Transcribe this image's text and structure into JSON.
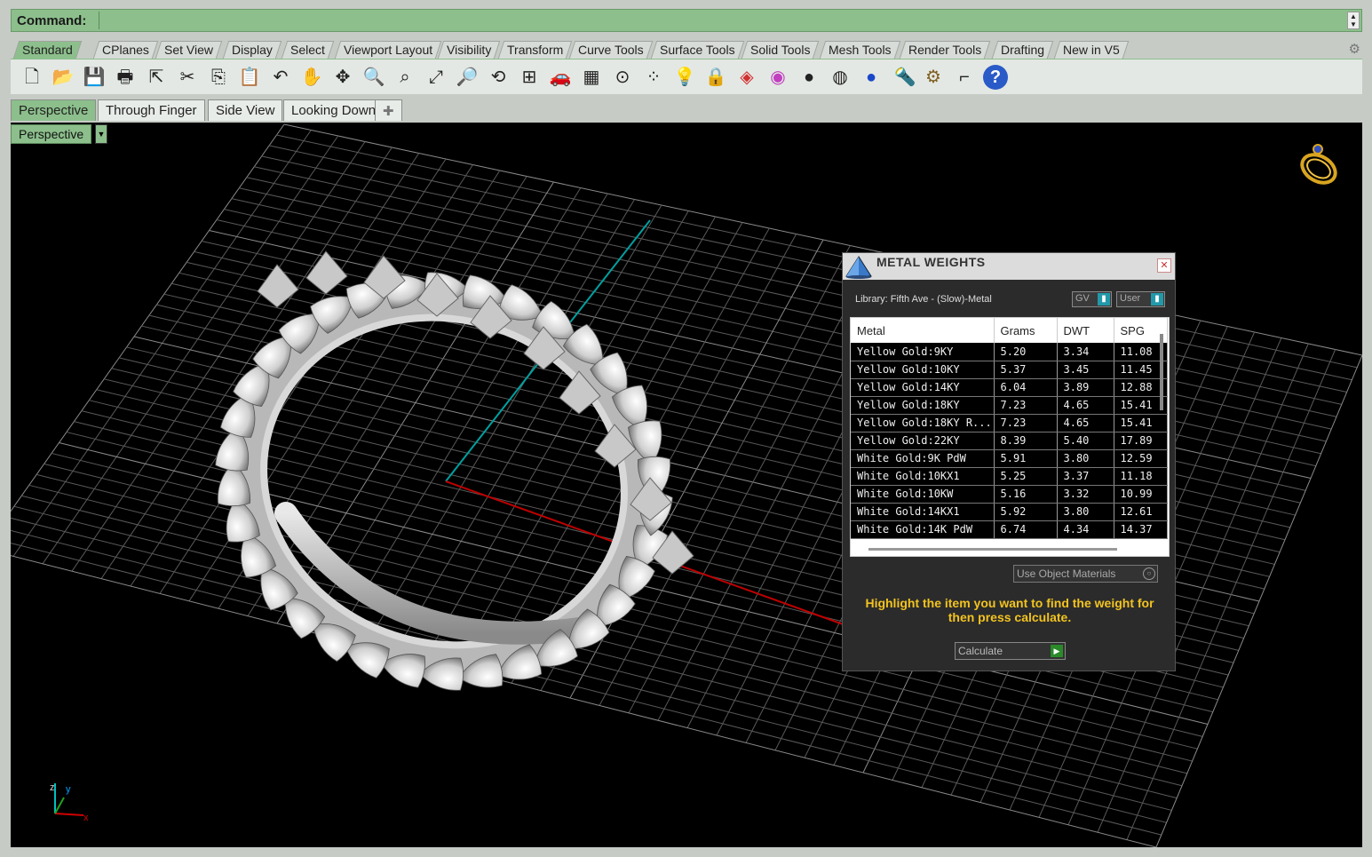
{
  "command": {
    "label": "Command:",
    "value": ""
  },
  "toolbar_tabs": [
    "Standard",
    "CPlanes",
    "Set View",
    "Display",
    "Select",
    "Viewport Layout",
    "Visibility",
    "Transform",
    "Curve Tools",
    "Surface Tools",
    "Solid Tools",
    "Mesh Tools",
    "Render Tools",
    "Drafting",
    "New in V5"
  ],
  "toolbar_icons": [
    "new-file-icon",
    "open-folder-icon",
    "save-icon",
    "print-icon",
    "export-icon",
    "cut-icon",
    "copy-icon",
    "paste-icon",
    "undo-icon",
    "pan-hand-icon",
    "move-icon",
    "zoom-icon",
    "zoom-window-icon",
    "zoom-extents-icon",
    "zoom-selected-icon",
    "rotate-view-icon",
    "four-viewports-icon",
    "car-icon",
    "grid-icon",
    "snap-icon",
    "points-icon",
    "light-bulb-icon",
    "lock-icon",
    "material-icon",
    "color-wheel-icon",
    "shaded-sphere-icon",
    "rendered-sphere-icon",
    "blue-sphere-icon",
    "flashlight-icon",
    "gear-icon",
    "dimension-icon",
    "help-icon"
  ],
  "viewport_tabs": [
    "Perspective",
    "Through Finger",
    "Side View",
    "Looking Down"
  ],
  "viewport": {
    "label": "Perspective"
  },
  "metal_weights": {
    "title": "METAL WEIGHTS",
    "library": "Library: Fifth Ave - (Slow)-Metal",
    "gv_button": "GV",
    "user_button": "User",
    "columns": [
      "Metal",
      "Grams",
      "DWT",
      "SPG"
    ],
    "rows": [
      [
        "Yellow Gold:9KY",
        "5.20",
        "3.34",
        "11.08"
      ],
      [
        "Yellow Gold:10KY",
        "5.37",
        "3.45",
        "11.45"
      ],
      [
        "Yellow Gold:14KY",
        "6.04",
        "3.89",
        "12.88"
      ],
      [
        "Yellow Gold:18KY",
        "7.23",
        "4.65",
        "15.41"
      ],
      [
        "Yellow Gold:18KY R...",
        "7.23",
        "4.65",
        "15.41"
      ],
      [
        "Yellow Gold:22KY",
        "8.39",
        "5.40",
        "17.89"
      ],
      [
        "White Gold:9K PdW",
        "5.91",
        "3.80",
        "12.59"
      ],
      [
        "White Gold:10KX1",
        "5.25",
        "3.37",
        "11.18"
      ],
      [
        "White Gold:10KW",
        "5.16",
        "3.32",
        "10.99"
      ],
      [
        "White Gold:14KX1",
        "5.92",
        "3.80",
        "12.61"
      ],
      [
        "White Gold:14K PdW",
        "6.74",
        "4.34",
        "14.37"
      ]
    ],
    "use_object_materials": "Use Object Materials",
    "hint": "Highlight the item you want to find the weight for then press calculate.",
    "calculate": "Calculate"
  },
  "axis": {
    "x": "x",
    "y": "y",
    "z": "z"
  },
  "colors": {
    "accent": "#8cbf8c",
    "hint": "#f2c320",
    "x_axis": "#c00000",
    "y_axis": "#00a0a0"
  }
}
